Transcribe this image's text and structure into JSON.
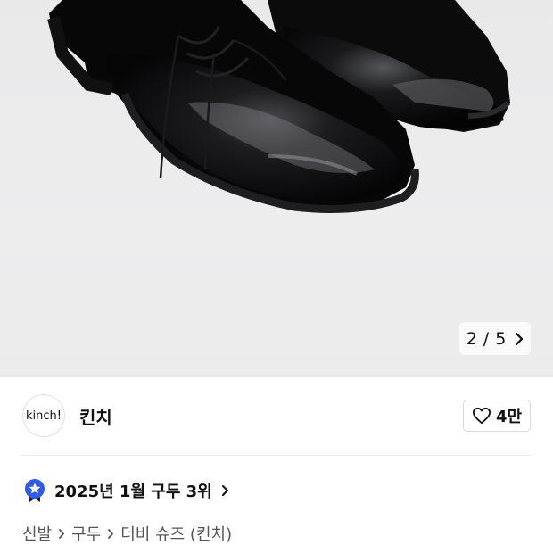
{
  "gallery": {
    "current": "2",
    "separator": "/",
    "total": "5",
    "image_alt": "black leather derby shoes"
  },
  "brand": {
    "logo_text": "kinch!",
    "name": "킨치",
    "likes": "4만"
  },
  "ranking": {
    "text": "2025년 1월 구두 3위"
  },
  "breadcrumbs": [
    "신발",
    "구두",
    "더비 슈즈 (킨치)"
  ],
  "colors": {
    "rank_badge": "#2f5bea",
    "rank_badge_tail": "#1a1a1a",
    "hero_bg": "#ebebec"
  },
  "icons": {
    "pager_next": "chevron-right-icon",
    "like": "heart-outline-icon",
    "rank": "star-badge-icon",
    "crumb_sep": "chevron-right-icon"
  }
}
